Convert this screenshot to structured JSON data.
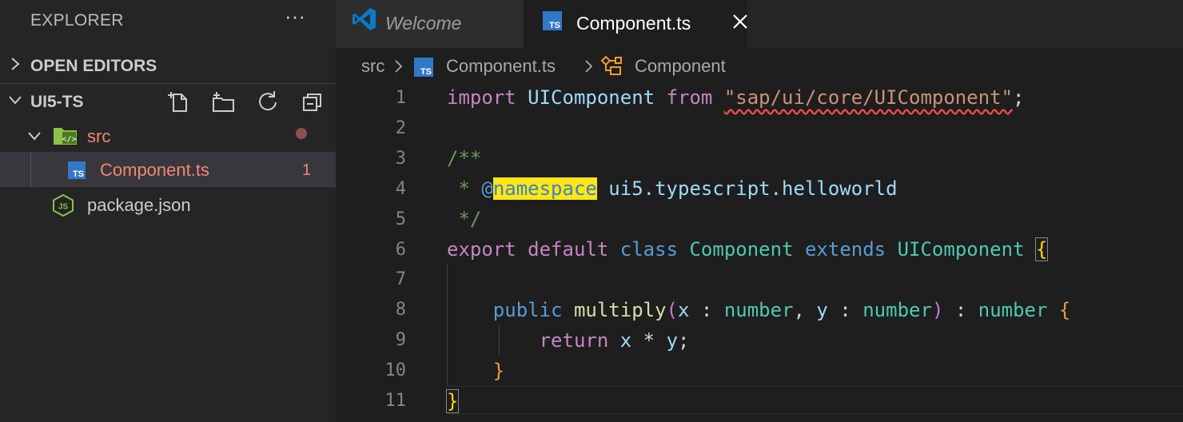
{
  "sidebar": {
    "title": "EXPLORER",
    "more_actions": "···",
    "open_editors_label": "OPEN EDITORS",
    "project_label": "UI5-TS",
    "tree": {
      "folder": "src",
      "file_component": "Component.ts",
      "file_component_problems": "1",
      "file_package": "package.json"
    },
    "ts_badge": "TS",
    "js_badge": "JS"
  },
  "tabs": {
    "welcome": "Welcome",
    "component": "Component.ts"
  },
  "breadcrumb": {
    "folder": "src",
    "file": "Component.ts",
    "symbol": "Component"
  },
  "editor": {
    "line_numbers": [
      "1",
      "2",
      "3",
      "4",
      "5",
      "6",
      "7",
      "8",
      "9",
      "10",
      "11"
    ],
    "code": {
      "l1_import": "import",
      "l1_ident": "UIComponent",
      "l1_from": "from",
      "l1_string": "\"sap/ui/core/UIComponent\"",
      "l1_semi": ";",
      "l3_open": "/**",
      "l4_star": " * ",
      "l4_at": "@",
      "l4_tag": "namespace",
      "l4_ns": " ui5.typescript.helloworld",
      "l5_close": " */",
      "l6_export": "export",
      "l6_default": "default",
      "l6_class": "class",
      "l6_name": "Component",
      "l6_extends": "extends",
      "l6_base": "UIComponent",
      "l6_brace": "{",
      "l8_public": "public",
      "l8_fn": "multiply",
      "l8_paren_open": "(",
      "l8_x": "x",
      "l8_colon1": " : ",
      "l8_type1": "number",
      "l8_comma": ", ",
      "l8_y": "y",
      "l8_colon2": " : ",
      "l8_type2": "number",
      "l8_paren_close": ")",
      "l8_colon3": " : ",
      "l8_type3": "number",
      "l8_brace": "{",
      "l9_return": "return",
      "l9_x": "x",
      "l9_op": " * ",
      "l9_y": "y",
      "l9_semi": ";",
      "l10_brace": "}",
      "l11_brace": "}"
    }
  },
  "colors": {
    "accent_ts": "#3178c6",
    "vscode_blue": "#0a7acc",
    "folder_green": "#8ac148",
    "error_text": "#f48771"
  }
}
